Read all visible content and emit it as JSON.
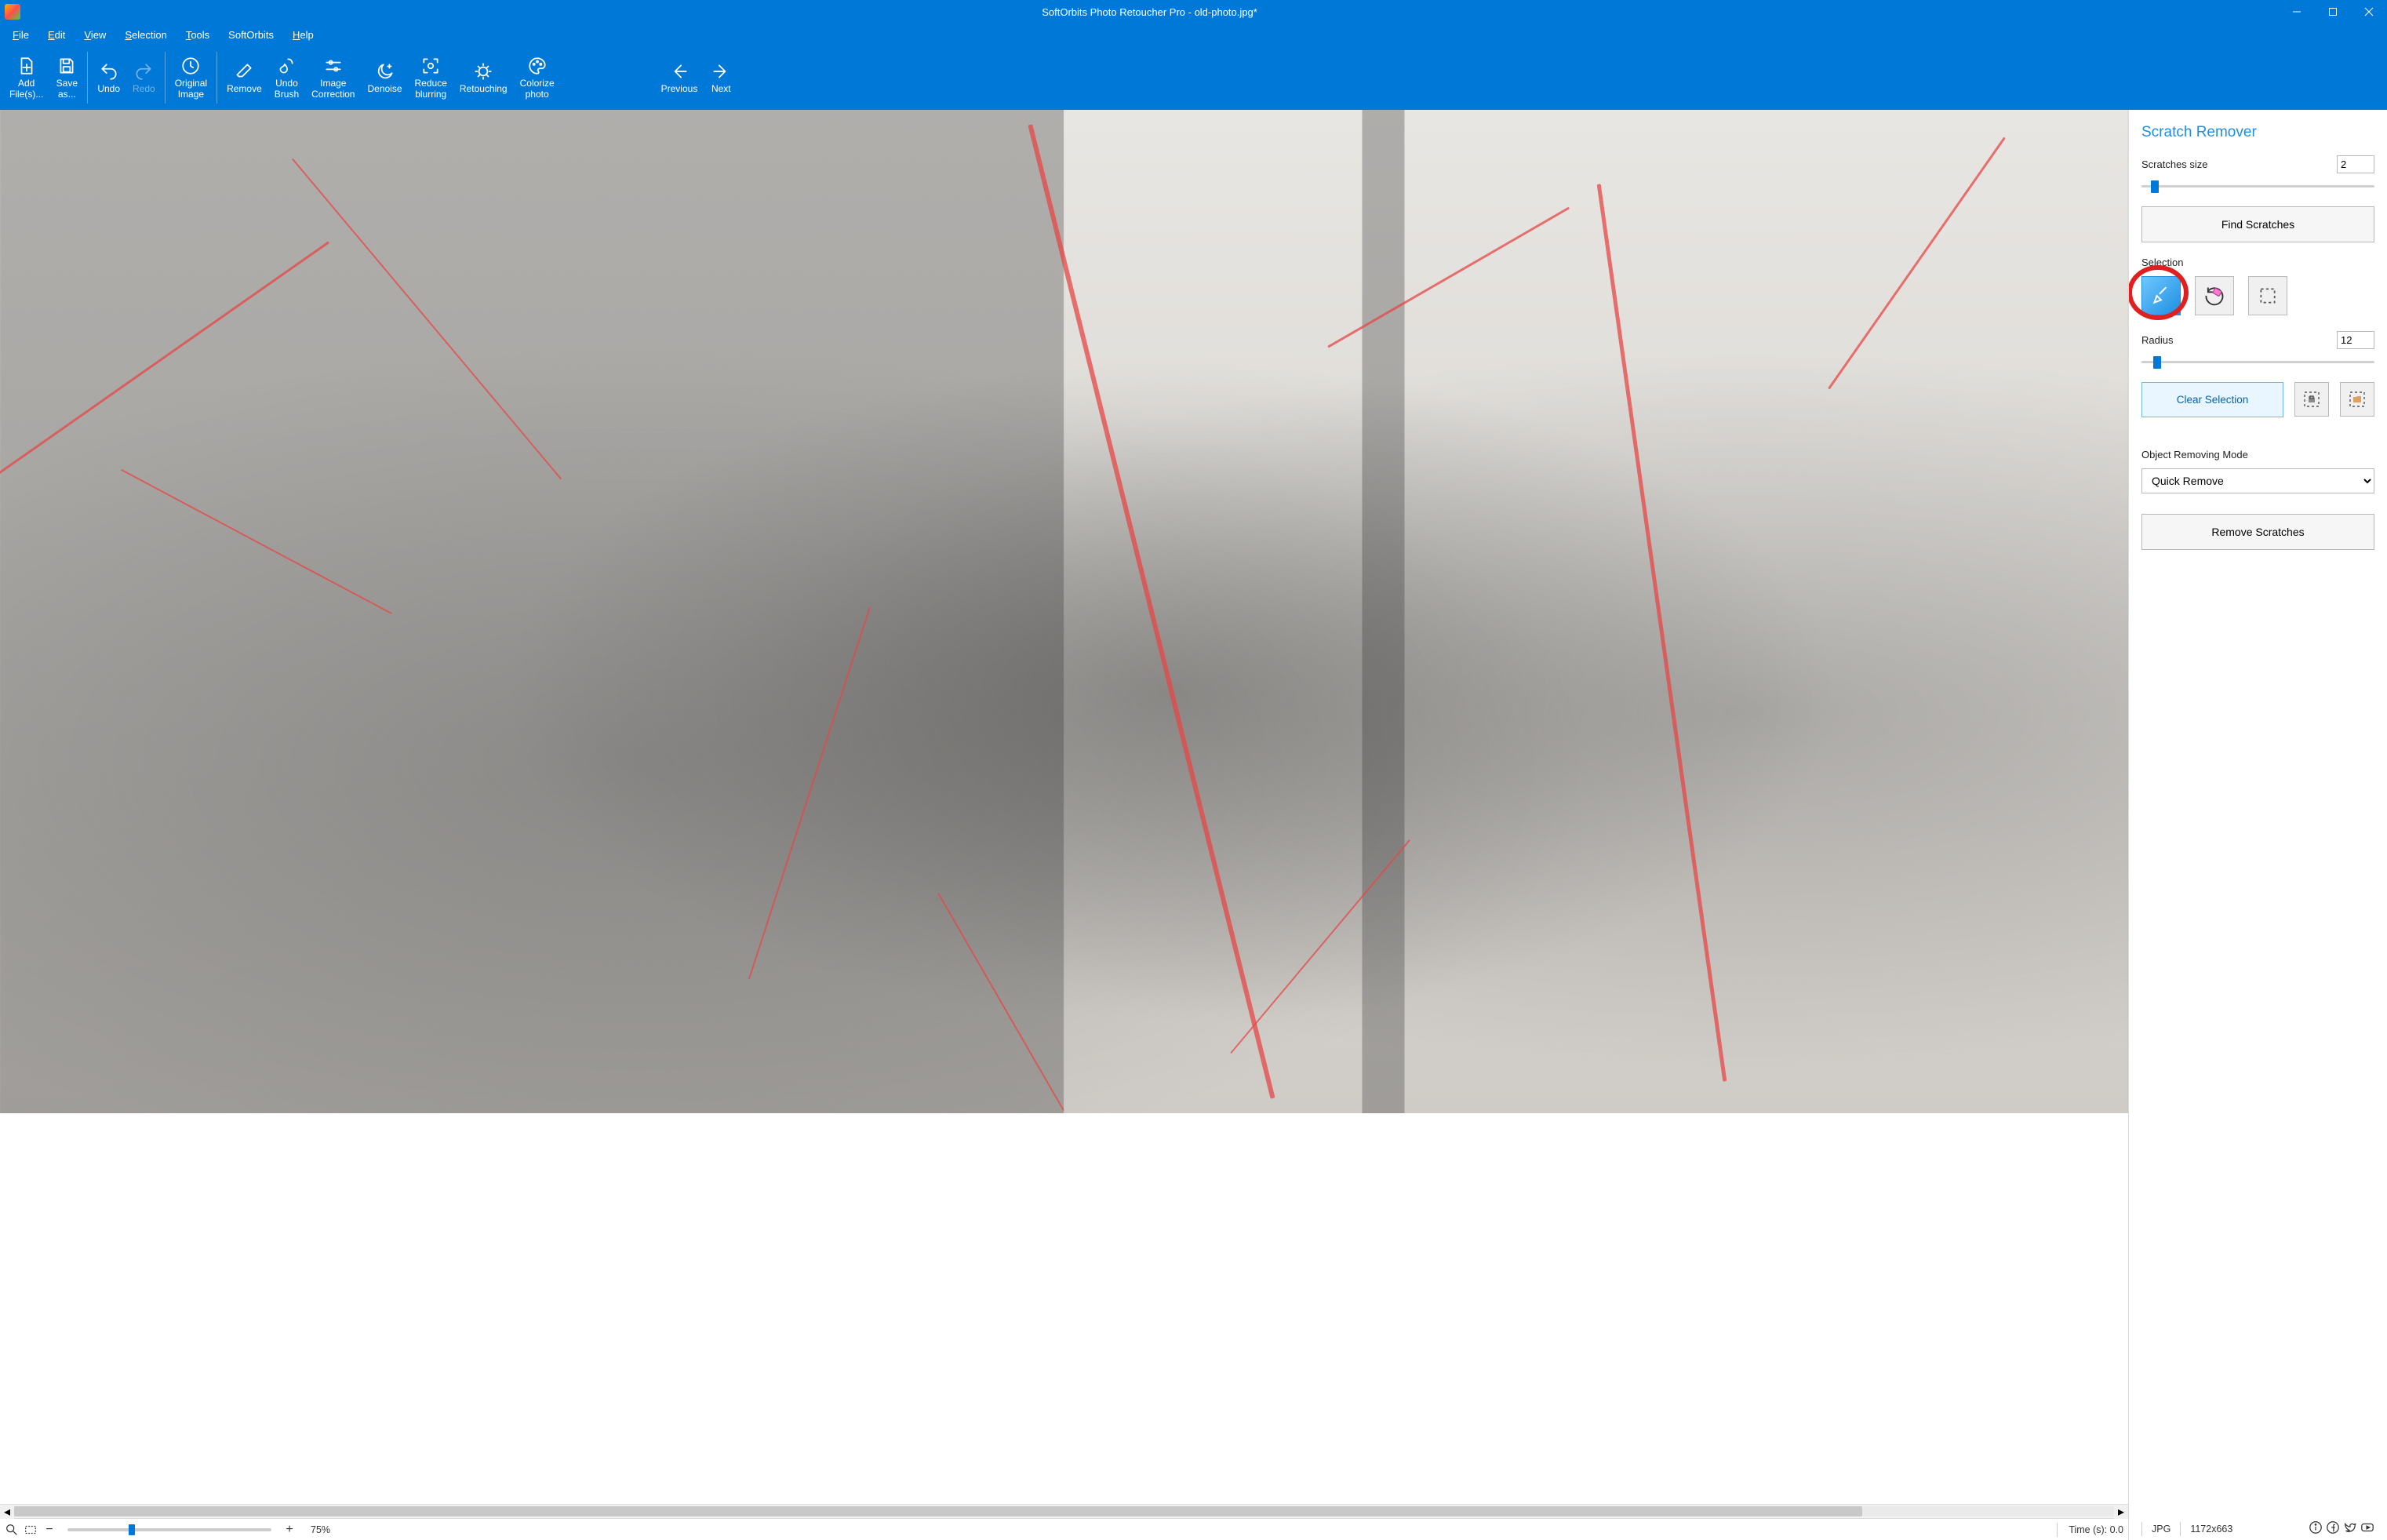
{
  "title": "SoftOrbits Photo Retoucher Pro - old-photo.jpg*",
  "menu": [
    "File",
    "Edit",
    "View",
    "Selection",
    "Tools",
    "SoftOrbits",
    "Help"
  ],
  "toolbar": {
    "add_files": "Add\nFile(s)...",
    "save_as": "Save\nas...",
    "undo": "Undo",
    "redo": "Redo",
    "original_image": "Original\nImage",
    "remove": "Remove",
    "undo_brush": "Undo\nBrush",
    "image_correction": "Image\nCorrection",
    "denoise": "Denoise",
    "reduce_blurring": "Reduce\nblurring",
    "retouching": "Retouching",
    "colorize_photo": "Colorize\nphoto",
    "previous": "Previous",
    "next": "Next"
  },
  "panel": {
    "header": "Scratch Remover",
    "scratches_size_label": "Scratches size",
    "scratches_size_value": "2",
    "find_scratches": "Find Scratches",
    "selection_label": "Selection",
    "radius_label": "Radius",
    "radius_value": "12",
    "clear_selection": "Clear Selection",
    "mode_label": "Object Removing Mode",
    "mode_value": "Quick Remove",
    "remove_scratches": "Remove Scratches"
  },
  "status": {
    "zoom": "75%",
    "time": "Time (s): 0.0",
    "format": "JPG",
    "dims": "1172x663"
  }
}
